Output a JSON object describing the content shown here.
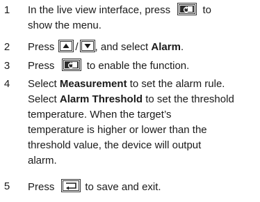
{
  "steps": [
    {
      "number": "1",
      "line1_before": "In the live view interface, press",
      "line1_after": "to",
      "line2": "show the menu."
    },
    {
      "number": "2",
      "before": "Press",
      "separator": "/",
      "middle": ", and select ",
      "bold": "Alarm",
      "after": "."
    },
    {
      "number": "3",
      "before": "Press",
      "after": "to enable the function."
    },
    {
      "number": "4",
      "l1_bold": "Select ",
      "l1_boldword": "Measurement",
      "l1_rest": " to set the alarm rule.",
      "l2_pre": "Select ",
      "l2_bold": "Alarm Threshold",
      "l2_rest": " to set the threshold",
      "l3": "temperature. When the target’s",
      "l4": "temperature is higher or lower than the",
      "l5": "threshold value, the device will output",
      "l6": "alarm."
    },
    {
      "number": "5",
      "before": "Press",
      "after": "to save and exit."
    }
  ],
  "icons": {
    "menu_key": "menu-key-icon",
    "up_key": "up-arrow-key-icon",
    "down_key": "down-arrow-key-icon",
    "back_key": "back-key-icon"
  }
}
